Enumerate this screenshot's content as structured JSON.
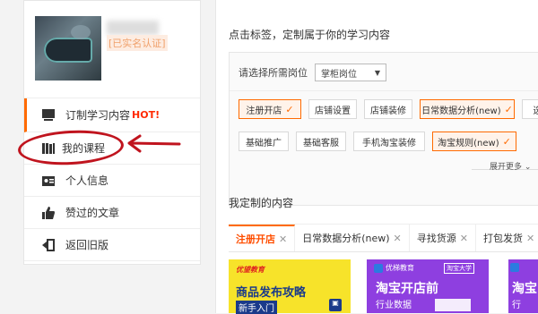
{
  "sidebar": {
    "verify_label": "[已实名认证]",
    "items": [
      {
        "label": "订制学习内容",
        "hot": "HOT!"
      },
      {
        "label": "我的课程"
      },
      {
        "label": "个人信息"
      },
      {
        "label": "赞过的文章"
      },
      {
        "label": "返回旧版"
      }
    ]
  },
  "main": {
    "header": "点击标签，定制属于你的学习内容",
    "filter": {
      "prompt": "请选择所需岗位",
      "selected_position": "掌柜岗位"
    },
    "tags": [
      {
        "label": "注册开店",
        "selected": true
      },
      {
        "label": "店铺设置",
        "selected": false
      },
      {
        "label": "店铺装修",
        "selected": false
      },
      {
        "label": "日常数据分析(new)",
        "selected": true
      },
      {
        "label": "选",
        "selected": false
      },
      {
        "label": "基础推广",
        "selected": false
      },
      {
        "label": "基础客服",
        "selected": false
      },
      {
        "label": "手机淘宝装修",
        "selected": false
      },
      {
        "label": "淘宝规则(new)",
        "selected": true
      }
    ],
    "more_label": "展开更多",
    "custom_title": "我定制的内容",
    "tabs": [
      {
        "label": "注册开店",
        "active": true
      },
      {
        "label": "日常数据分析(new)",
        "active": false
      },
      {
        "label": "寻找货源",
        "active": false
      },
      {
        "label": "打包发货",
        "active": false
      }
    ],
    "cards": [
      {
        "brand": "优望教育",
        "title": "商品发布攻略",
        "subtitle": "新手入门"
      },
      {
        "brand": "优梯教育",
        "badge": "淘宝大学",
        "title": "淘宝开店前",
        "subtitle": "行业数据"
      },
      {
        "brand": "",
        "title": "淘宝",
        "subtitle": "行"
      }
    ]
  },
  "colors": {
    "accent": "#ff6a00",
    "annotation": "#c0141e"
  }
}
